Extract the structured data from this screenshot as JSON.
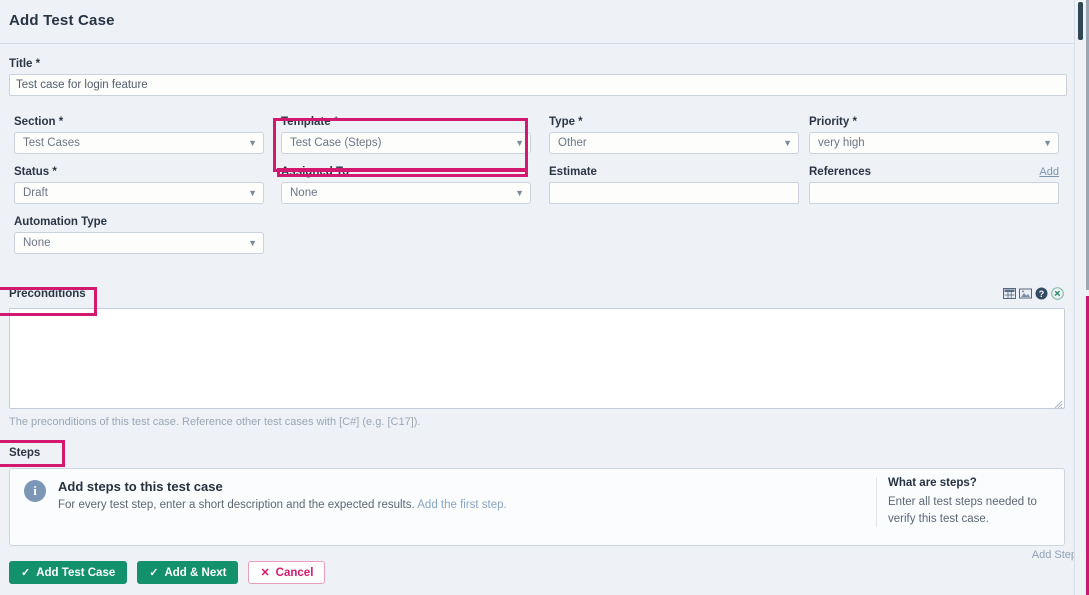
{
  "header": {
    "title": "Add Test Case"
  },
  "title_field": {
    "label": "Title *",
    "value": "Test case for login feature",
    "placeholder": ""
  },
  "fields": {
    "section": {
      "label": "Section *",
      "value": "Test Cases"
    },
    "template": {
      "label": "Template *",
      "value": "Test Case (Steps)"
    },
    "type": {
      "label": "Type *",
      "value": "Other"
    },
    "priority": {
      "label": "Priority *",
      "value": "very high"
    },
    "status": {
      "label": "Status *",
      "value": "Draft"
    },
    "assigned_to": {
      "label": "Assigned To",
      "value": "None"
    },
    "estimate": {
      "label": "Estimate",
      "value": "",
      "placeholder": ""
    },
    "references": {
      "label": "References",
      "value": "",
      "placeholder": "",
      "add_label": "Add"
    },
    "automation_type": {
      "label": "Automation Type",
      "value": "None"
    }
  },
  "preconditions": {
    "label": "Preconditions",
    "value": "",
    "help": "The preconditions of this test case. Reference other test cases with [C#] (e.g. [C17]).",
    "icons": [
      "table-icon",
      "image-icon",
      "help-icon",
      "fullscreen-toggle-icon"
    ]
  },
  "steps": {
    "label": "Steps",
    "title": "Add steps to this test case",
    "desc_prefix": "For every test step, enter a short description and the expected results.",
    "desc_link": "Add the first step.",
    "aside_title": "What are steps?",
    "aside_body": "Enter all test steps needed to verify this test case.",
    "add_step_label": "Add Step"
  },
  "footer": {
    "add_test_case": "Add Test Case",
    "add_and_next": "Add & Next",
    "cancel": "Cancel",
    "check_glyph": "✓",
    "x_glyph": "✕"
  },
  "colors": {
    "accent_green": "#12916c",
    "accent_magenta": "#d2196f",
    "page_bg": "#eef2f7",
    "link": "#8aa4c2"
  }
}
